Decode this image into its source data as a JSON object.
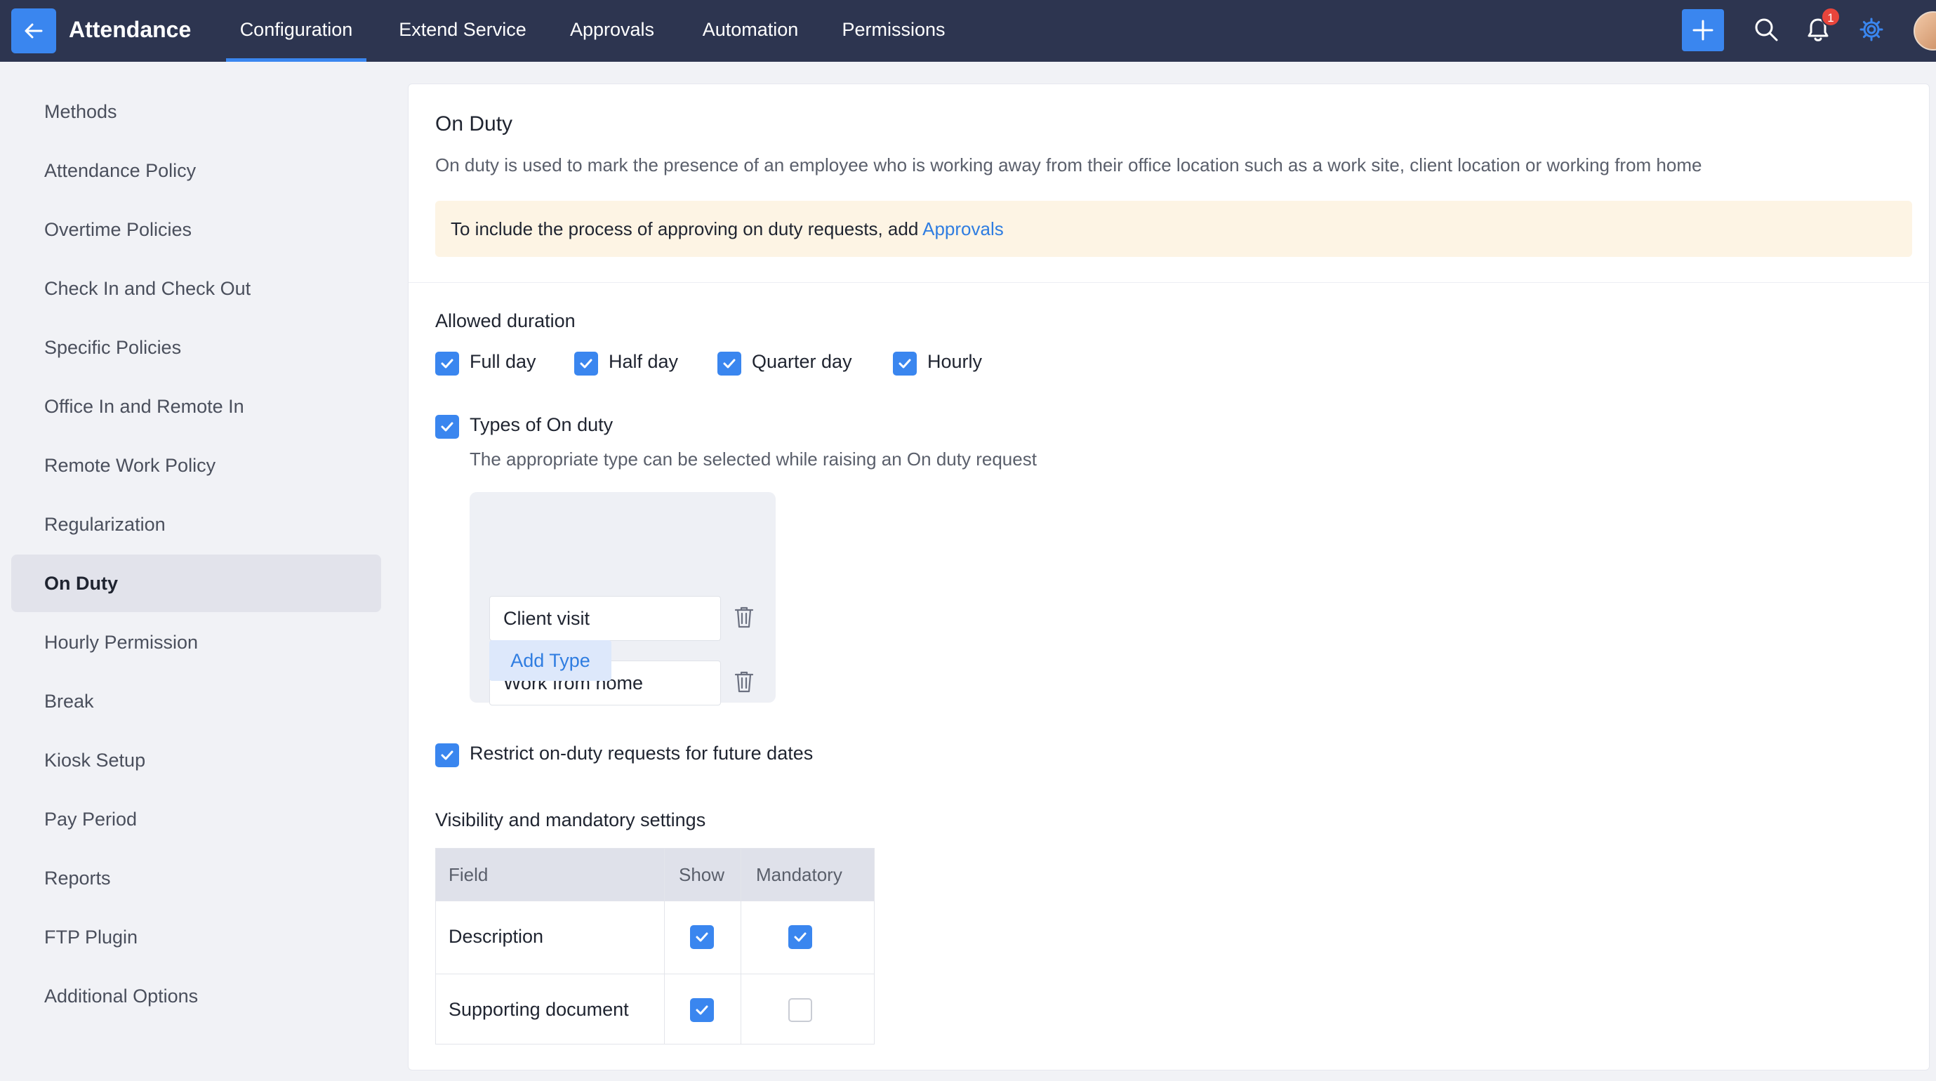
{
  "header": {
    "app_title": "Attendance",
    "tabs": [
      {
        "label": "Configuration",
        "active": true
      },
      {
        "label": "Extend Service",
        "active": false
      },
      {
        "label": "Approvals",
        "active": false
      },
      {
        "label": "Automation",
        "active": false
      },
      {
        "label": "Permissions",
        "active": false
      }
    ],
    "notification_count": "1",
    "accent_color": "#3a86ef",
    "bar_color": "#2d3550"
  },
  "sidebar": {
    "items": [
      {
        "label": "Methods",
        "active": false
      },
      {
        "label": "Attendance Policy",
        "active": false
      },
      {
        "label": "Overtime Policies",
        "active": false
      },
      {
        "label": "Check In and Check Out",
        "active": false
      },
      {
        "label": "Specific Policies",
        "active": false
      },
      {
        "label": "Office In and Remote In",
        "active": false
      },
      {
        "label": "Remote Work Policy",
        "active": false
      },
      {
        "label": "Regularization",
        "active": false
      },
      {
        "label": "On Duty",
        "active": true
      },
      {
        "label": "Hourly Permission",
        "active": false
      },
      {
        "label": "Break",
        "active": false
      },
      {
        "label": "Kiosk Setup",
        "active": false
      },
      {
        "label": "Pay Period",
        "active": false
      },
      {
        "label": "Reports",
        "active": false
      },
      {
        "label": "FTP Plugin",
        "active": false
      },
      {
        "label": "Additional Options",
        "active": false
      }
    ]
  },
  "main": {
    "title": "On Duty",
    "description": "On duty is used to mark the presence of an employee who is working away from their office location such as a work site, client location or working from home",
    "notice_text": "To include the process of approving on duty requests, add ",
    "notice_link": "Approvals",
    "allowed_duration": {
      "label": "Allowed duration",
      "options": [
        {
          "label": "Full day",
          "checked": true
        },
        {
          "label": "Half day",
          "checked": true
        },
        {
          "label": "Quarter day",
          "checked": true
        },
        {
          "label": "Hourly",
          "checked": true
        }
      ]
    },
    "types": {
      "label": "Types of On duty",
      "checked": true,
      "description": "The appropriate type can be selected while raising an On duty request",
      "items": [
        "Client visit",
        "Work from home"
      ],
      "add_label": "Add Type"
    },
    "restrict": {
      "label": "Restrict on-duty requests for future dates",
      "checked": true
    },
    "visibility": {
      "label": "Visibility and mandatory settings",
      "columns": [
        "Field",
        "Show",
        "Mandatory"
      ],
      "rows": [
        {
          "field": "Description",
          "show": true,
          "mandatory": true
        },
        {
          "field": "Supporting document",
          "show": true,
          "mandatory": false
        }
      ]
    }
  }
}
